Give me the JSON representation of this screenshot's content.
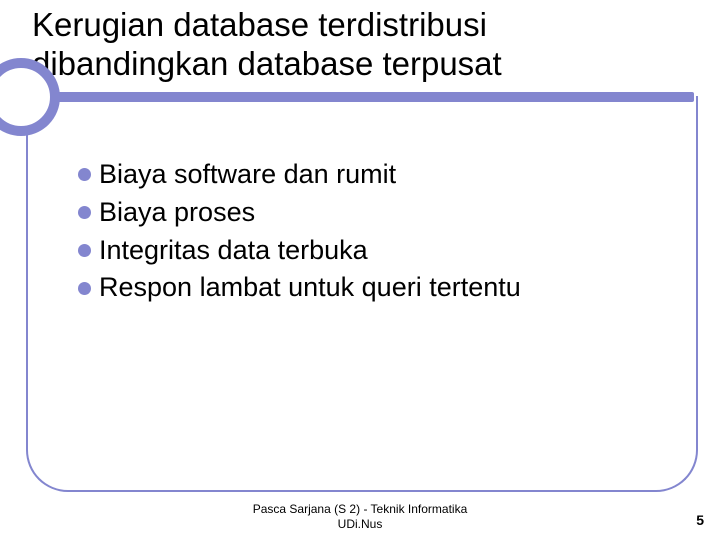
{
  "title": "Kerugian database terdistribusi dibandingkan database terpusat",
  "bullets": [
    "Biaya software dan rumit",
    "Biaya proses",
    "Integritas data terbuka",
    "Respon lambat untuk queri tertentu"
  ],
  "footer_line1": "Pasca Sarjana (S 2) - Teknik Informatika",
  "footer_line2": "UDi.Nus",
  "page_number": "5"
}
